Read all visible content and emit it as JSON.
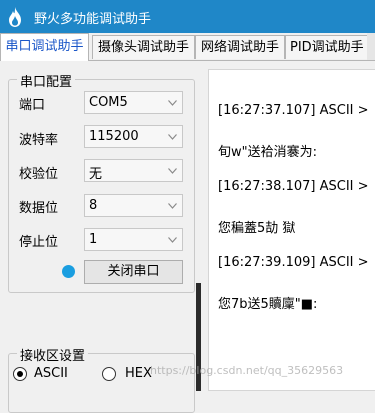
{
  "window": {
    "title": "野火多功能调试助手",
    "title_color": "#1f87c8"
  },
  "tabs": [
    {
      "label": "串口调试助手",
      "active": true
    },
    {
      "label": "摄像头调试助手",
      "active": false
    },
    {
      "label": "网络调试助手",
      "active": false
    },
    {
      "label": "PID调试助手",
      "active": false
    }
  ],
  "serial_config": {
    "legend": "串口配置",
    "fields": [
      {
        "label": "端口",
        "value": "COM5"
      },
      {
        "label": "波特率",
        "value": "115200"
      },
      {
        "label": "校验位",
        "value": "无"
      },
      {
        "label": "数据位",
        "value": "8"
      },
      {
        "label": "停止位",
        "value": "1"
      }
    ],
    "status_color": "#1a9ee0",
    "close_button": "关闭串口"
  },
  "receive_settings": {
    "legend": "接收区设置",
    "options": [
      {
        "label": "ASCII",
        "checked": true
      },
      {
        "label": "HEX",
        "checked": false
      }
    ]
  },
  "log": {
    "lines": [
      "[16:27:37.107] ASCII >",
      "旬w\"送袷消褰为:",
      "[16:27:38.107] ASCII >",
      "您稨蓋5劼        獄",
      "[16:27:39.109] ASCII >",
      "您7b送5贖廩\"■:"
    ]
  },
  "watermark": "https://blog.csdn.net/qq_35629563"
}
